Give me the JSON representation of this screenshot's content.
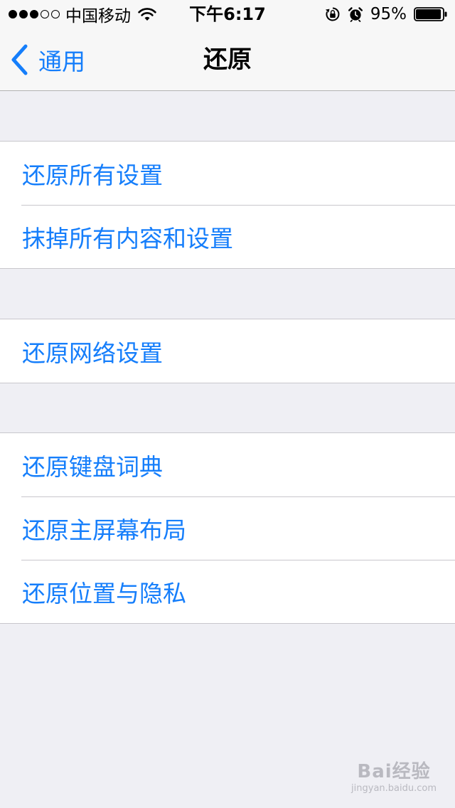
{
  "status_bar": {
    "signal": "●●●○○",
    "carrier": "中国移动",
    "time": "下午6:17",
    "battery_percent": "95%",
    "battery_level": 0.95,
    "icons": [
      "wifi-icon",
      "rotation-lock-icon",
      "alarm-icon",
      "battery-icon"
    ]
  },
  "nav": {
    "back_label": "通用",
    "title": "还原"
  },
  "groups": [
    {
      "items": [
        "还原所有设置",
        "抹掉所有内容和设置"
      ]
    },
    {
      "items": [
        "还原网络设置"
      ]
    },
    {
      "items": [
        "还原键盘词典",
        "还原主屏幕布局",
        "还原位置与隐私"
      ]
    }
  ],
  "watermark": {
    "main": "Bai经验",
    "sub": "jingyan.baidu.com"
  },
  "colors": {
    "accent": "#157efb",
    "background": "#efeff4",
    "cell_background": "#ffffff",
    "separator": "#c8c7cc"
  }
}
